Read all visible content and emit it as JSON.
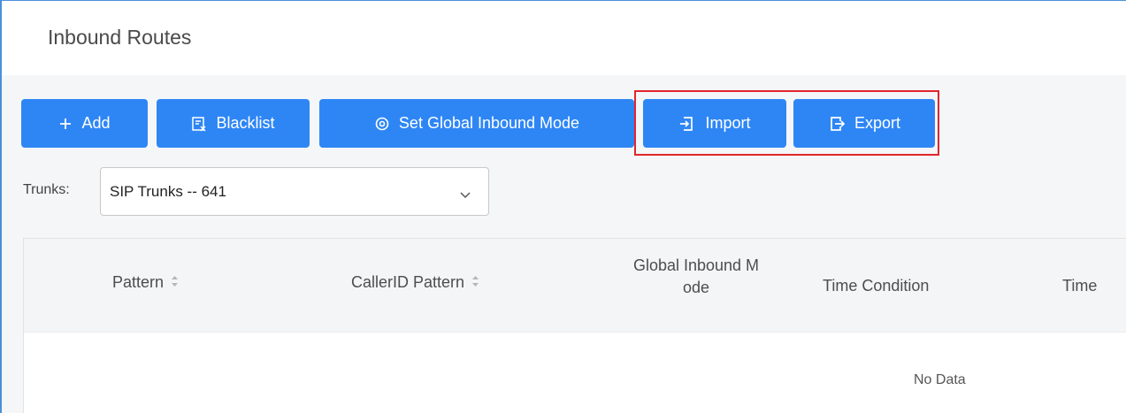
{
  "page": {
    "title": "Inbound Routes"
  },
  "toolbar": {
    "add_label": "Add",
    "blacklist_label": "Blacklist",
    "global_mode_label": "Set Global Inbound Mode",
    "import_label": "Import",
    "export_label": "Export"
  },
  "filter": {
    "label": "Trunks:",
    "selected": "SIP Trunks -- 641"
  },
  "table": {
    "columns": [
      "Pattern",
      "CallerID Pattern",
      "Global Inbound M",
      "ode",
      "Time Condition",
      "Time"
    ],
    "empty_text": "No Data"
  },
  "colors": {
    "accent": "#2e86f5",
    "highlight": "#e0262c",
    "frame": "#4a90d9"
  }
}
